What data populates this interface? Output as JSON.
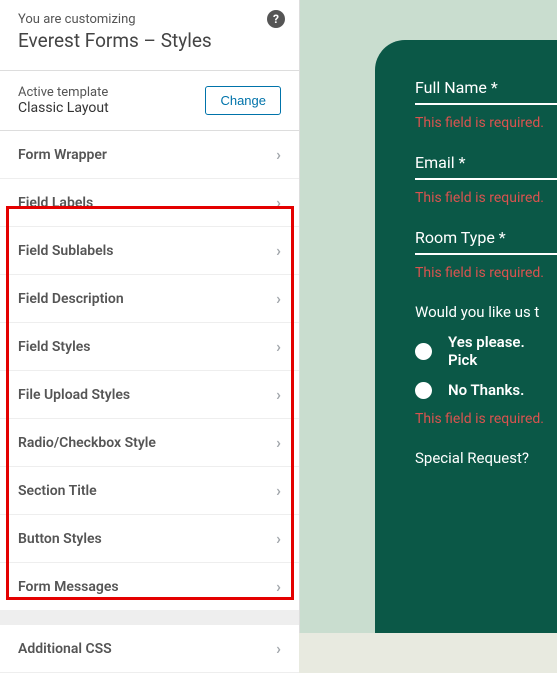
{
  "header": {
    "subtitle": "You are customizing",
    "title": "Everest Forms – Styles"
  },
  "template": {
    "label": "Active template",
    "name": "Classic Layout",
    "change_btn": "Change"
  },
  "menu": {
    "items": [
      "Form Wrapper",
      "Field Labels",
      "Field Sublabels",
      "Field Description",
      "Field Styles",
      "File Upload Styles",
      "Radio/Checkbox Style",
      "Section Title",
      "Button Styles",
      "Form Messages",
      "Additional CSS"
    ]
  },
  "preview": {
    "fields": {
      "name_label": "Full Name *",
      "email_label": "Email *",
      "room_label": "Room Type *",
      "error": "This field is required.",
      "pickup_q": "Would you like us t",
      "radio_yes": "Yes please. Pick",
      "radio_no": "No Thanks.",
      "special": "Special Request?"
    }
  }
}
